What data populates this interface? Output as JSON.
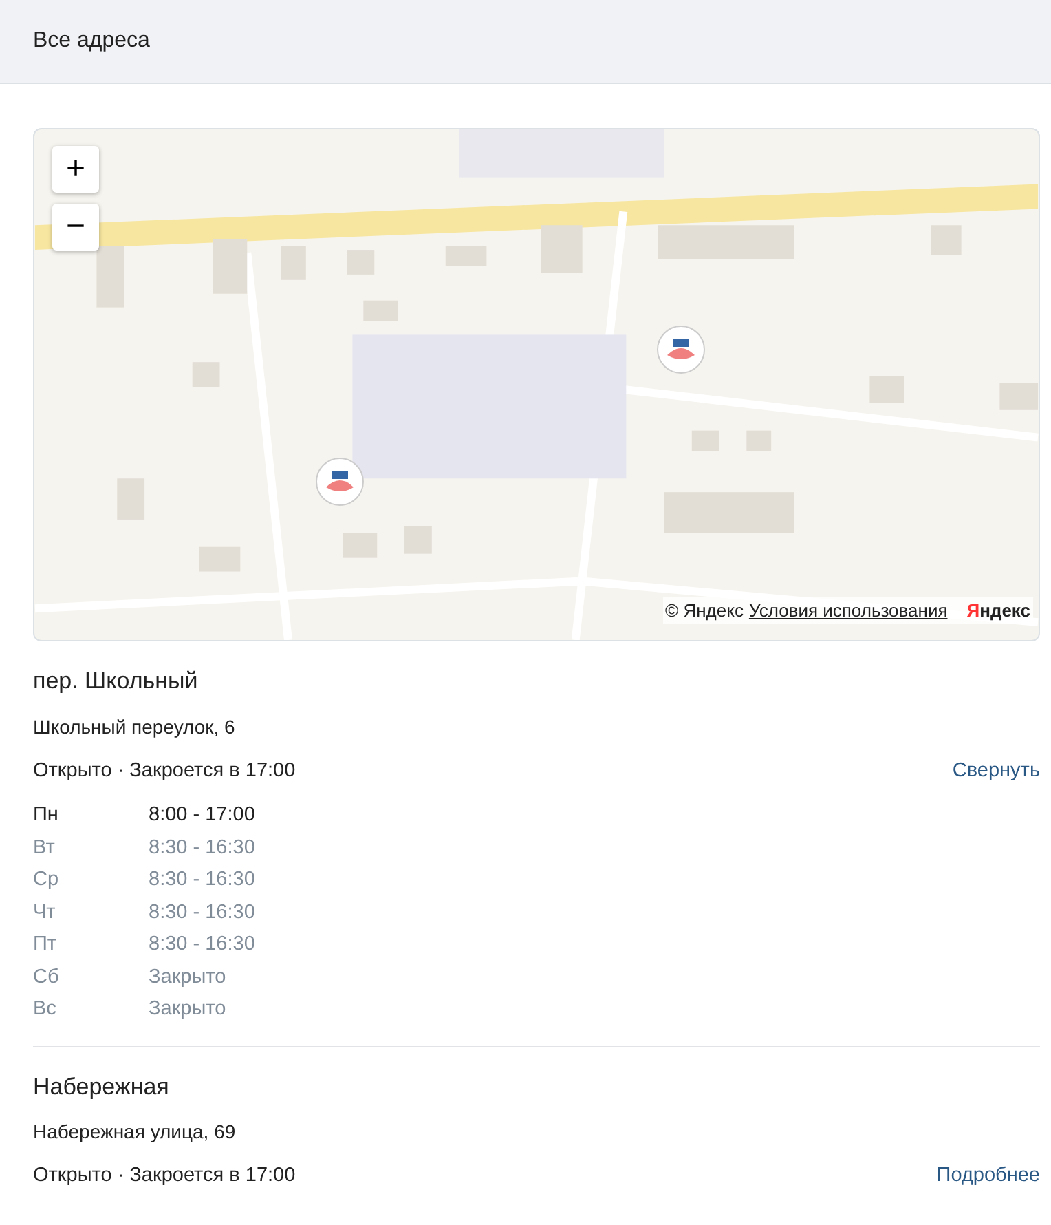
{
  "header": {
    "title": "Все адреса"
  },
  "map": {
    "zoom_in": "+",
    "zoom_out": "−",
    "copyright": "© Яндекс",
    "terms_link": "Условия использования",
    "logo": "Яндекс"
  },
  "locations": [
    {
      "name": "пер. Школьный",
      "address": "Школьный переулок, 6",
      "status": "Открыто · Закроется в 17:00",
      "toggle": "Свернуть",
      "expanded": true,
      "hours": [
        {
          "day": "Пн",
          "time": "8:00 - 17:00",
          "current": true
        },
        {
          "day": "Вт",
          "time": "8:30 - 16:30",
          "current": false
        },
        {
          "day": "Ср",
          "time": "8:30 - 16:30",
          "current": false
        },
        {
          "day": "Чт",
          "time": "8:30 - 16:30",
          "current": false
        },
        {
          "day": "Пт",
          "time": "8:30 - 16:30",
          "current": false
        },
        {
          "day": "Сб",
          "time": "Закрыто",
          "current": false
        },
        {
          "day": "Вс",
          "time": "Закрыто",
          "current": false
        }
      ]
    },
    {
      "name": "Набережная",
      "address": "Набережная улица, 69",
      "status": "Открыто · Закроется в 17:00",
      "toggle": "Подробнее",
      "expanded": false
    }
  ]
}
